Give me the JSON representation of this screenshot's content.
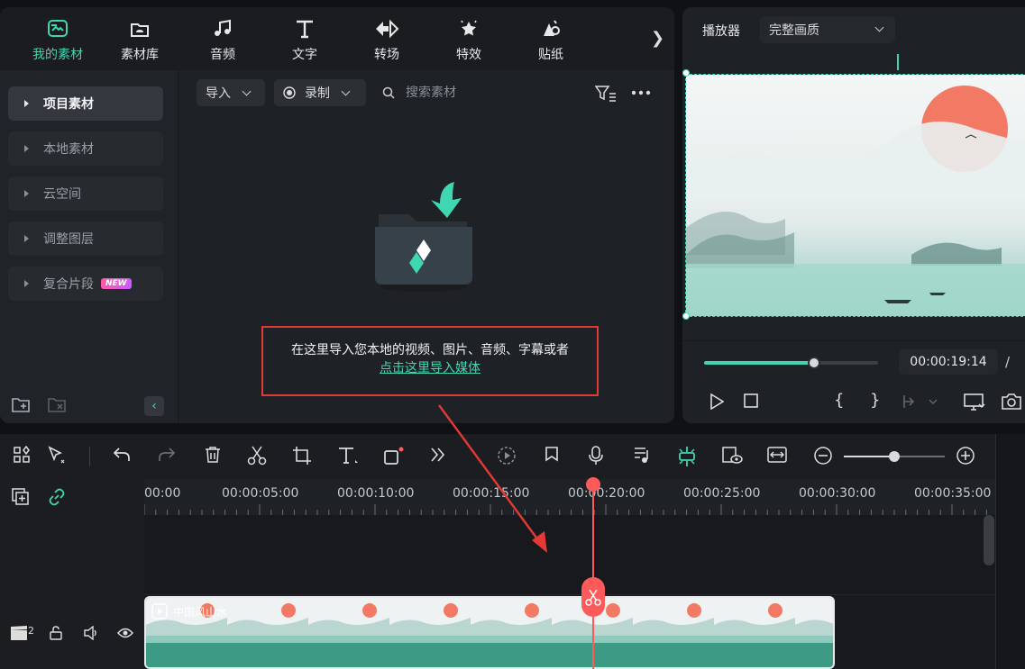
{
  "categories": [
    {
      "label": "我的素材",
      "icon": "my-media-icon"
    },
    {
      "label": "素材库",
      "icon": "stock-library-icon"
    },
    {
      "label": "音频",
      "icon": "music-note-icon"
    },
    {
      "label": "文字",
      "icon": "text-icon"
    },
    {
      "label": "转场",
      "icon": "transition-icon"
    },
    {
      "label": "特效",
      "icon": "effects-icon"
    },
    {
      "label": "贴纸",
      "icon": "sticker-icon"
    }
  ],
  "sidebar": {
    "items": [
      {
        "label": "项目素材"
      },
      {
        "label": "本地素材"
      },
      {
        "label": "云空间"
      },
      {
        "label": "调整图层"
      },
      {
        "label": "复合片段",
        "badge": "NEW"
      }
    ]
  },
  "library_toolbar": {
    "import_label": "导入",
    "record_label": "录制",
    "search_placeholder": "搜索素材"
  },
  "empty_state": {
    "hint": "在这里导入您本地的视频、图片、音频、字幕或者",
    "link": "点击这里导入媒体"
  },
  "player": {
    "title": "播放器",
    "quality": "完整画质",
    "timecode": "00:00:19:14",
    "separator": "/",
    "progress": 0.63
  },
  "timeline": {
    "ruler_labels": [
      "00:00",
      "00:00:05:00",
      "00:00:10:00",
      "00:00:15:00",
      "00:00:20:00",
      "00:00:25:00",
      "00:00:30:00",
      "00:00:35:00"
    ],
    "track_number": "2",
    "clip_name": "中国风山水",
    "zoom": 0.5
  },
  "colors": {
    "accent": "#3fd7b2",
    "playhead": "#ff5a5a",
    "annotation": "#e53935"
  }
}
